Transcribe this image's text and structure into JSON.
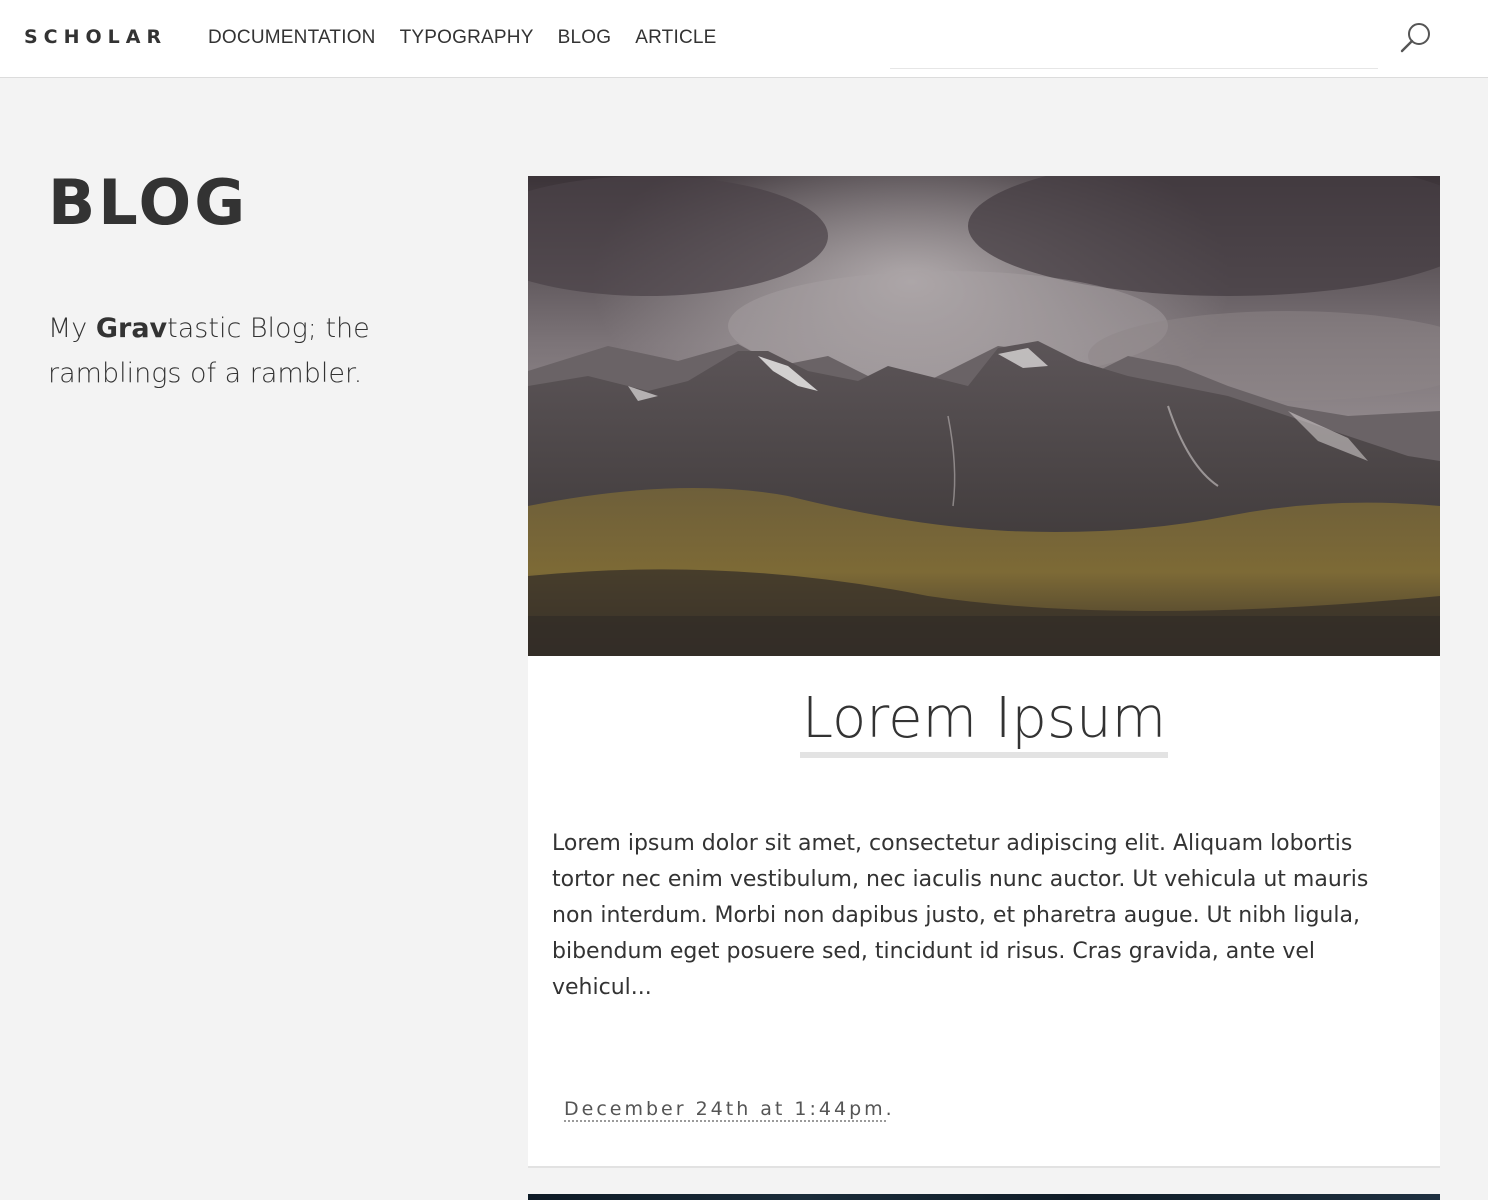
{
  "header": {
    "logo": "SCHOLAR",
    "nav": [
      {
        "label": "DOCUMENTATION"
      },
      {
        "label": "TYPOGRAPHY"
      },
      {
        "label": "BLOG"
      },
      {
        "label": "ARTICLE"
      }
    ],
    "search_icon": "search-icon"
  },
  "sidebar": {
    "heading": "BLOG",
    "tagline_pre": "My ",
    "tagline_bold": "Grav",
    "tagline_post": "tastic Blog; the ramblings of a rambler."
  },
  "post": {
    "image": "mountain-landscape-photo",
    "title": "Lorem Ipsum",
    "excerpt": "Lorem ipsum dolor sit amet, consectetur adipiscing elit. Aliquam lobortis tortor nec enim vestibulum, nec iaculis nunc auctor. Ut vehicula ut mauris non interdum. Morbi non dapibus justo, et pharetra augue. Ut nibh ligula, bibendum eget posuere sed, tincidunt id risus. Cras gravida, ante vel vehicul...",
    "date": "December 24th at 1:44pm",
    "date_suffix": "."
  },
  "colors": {
    "page_bg": "#f3f3f3",
    "header_bg": "#ffffff",
    "text": "#333333"
  }
}
